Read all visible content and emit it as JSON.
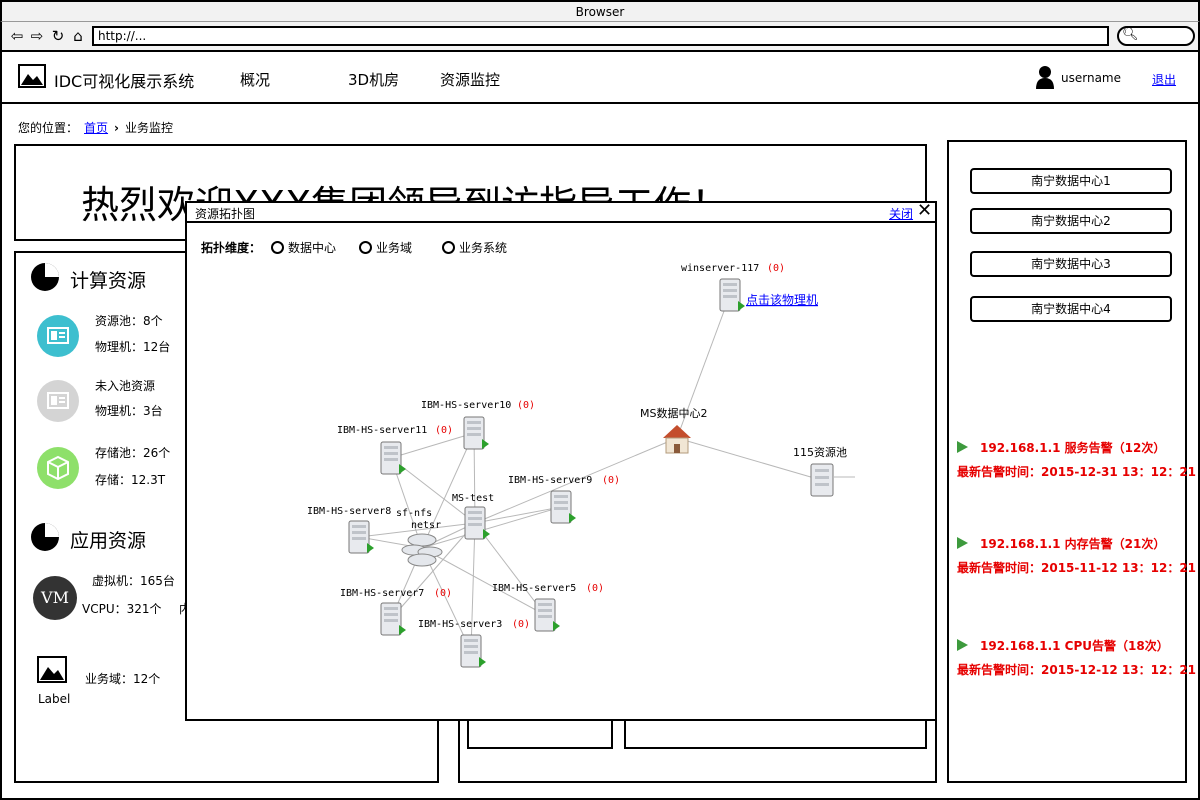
{
  "browser": {
    "title": "Browser",
    "url": "http://..."
  },
  "header": {
    "app_title": "IDC可视化展示系统",
    "nav": [
      "概况",
      "3D机房",
      "资源监控"
    ],
    "username": "username",
    "logout": "退出"
  },
  "breadcrumb": {
    "prefix": "您的位置：",
    "home": "首页",
    "current": "业务监控"
  },
  "banner": {
    "text": "热烈欢迎XXX集团领导到访指导工作！"
  },
  "compute": {
    "title": "计算资源",
    "pool": [
      "资源池：8个",
      "物理机：12台"
    ],
    "unpooled": [
      "未入池资源",
      "物理机：3台"
    ],
    "storage": [
      "存储池：26个",
      "存储：12.3T"
    ]
  },
  "app_resources": {
    "title": "应用资源",
    "vm_icon": "VM",
    "vm": "虚拟机：165台",
    "vcpu": "VCPU：321个",
    "vcpu_tail": "内",
    "domain": "业务域：12个",
    "label": "Label"
  },
  "right_panel": {
    "datacenters": [
      "南宁数据中心1",
      "南宁数据中心2",
      "南宁数据中心3",
      "南宁数据中心4"
    ],
    "alerts": [
      {
        "title": "192.168.1.1 服务告警（12次）",
        "time": "最新告警时间：2015-12-31 13：12：21"
      },
      {
        "title": "192.168.1.1 内存告警（21次）",
        "time": "最新告警时间：2015-11-12 13：12：21"
      },
      {
        "title": "192.168.1.1 CPU告警（18次）",
        "time": "最新告警时间：2015-12-12 13：12：21"
      }
    ],
    "alert_color": "#e60000"
  },
  "dialog": {
    "title": "资源拓扑图",
    "close": "关闭",
    "dimension_label": "拓扑维度：",
    "options": [
      "数据中心",
      "业务域",
      "业务系统"
    ],
    "topology": {
      "link_text": "点击该物理机",
      "datacenter": "MS数据中心2",
      "pool": "115资源池",
      "center_nodes": [
        "sf-nfs",
        "netsr"
      ],
      "servers": [
        {
          "name": "winserver-117",
          "count": "(0)"
        },
        {
          "name": "IBM-HS-server10",
          "count": "(0)"
        },
        {
          "name": "IBM-HS-server11",
          "count": "(0)"
        },
        {
          "name": "IBM-HS-server9",
          "count": "(0)"
        },
        {
          "name": "MS-test",
          "count": ""
        },
        {
          "name": "IBM-HS-server8",
          "count": ""
        },
        {
          "name": "IBM-HS-server7",
          "count": "(0)"
        },
        {
          "name": "IBM-HS-server5",
          "count": "(0)"
        },
        {
          "name": "IBM-HS-server3",
          "count": "(0)"
        }
      ]
    }
  }
}
